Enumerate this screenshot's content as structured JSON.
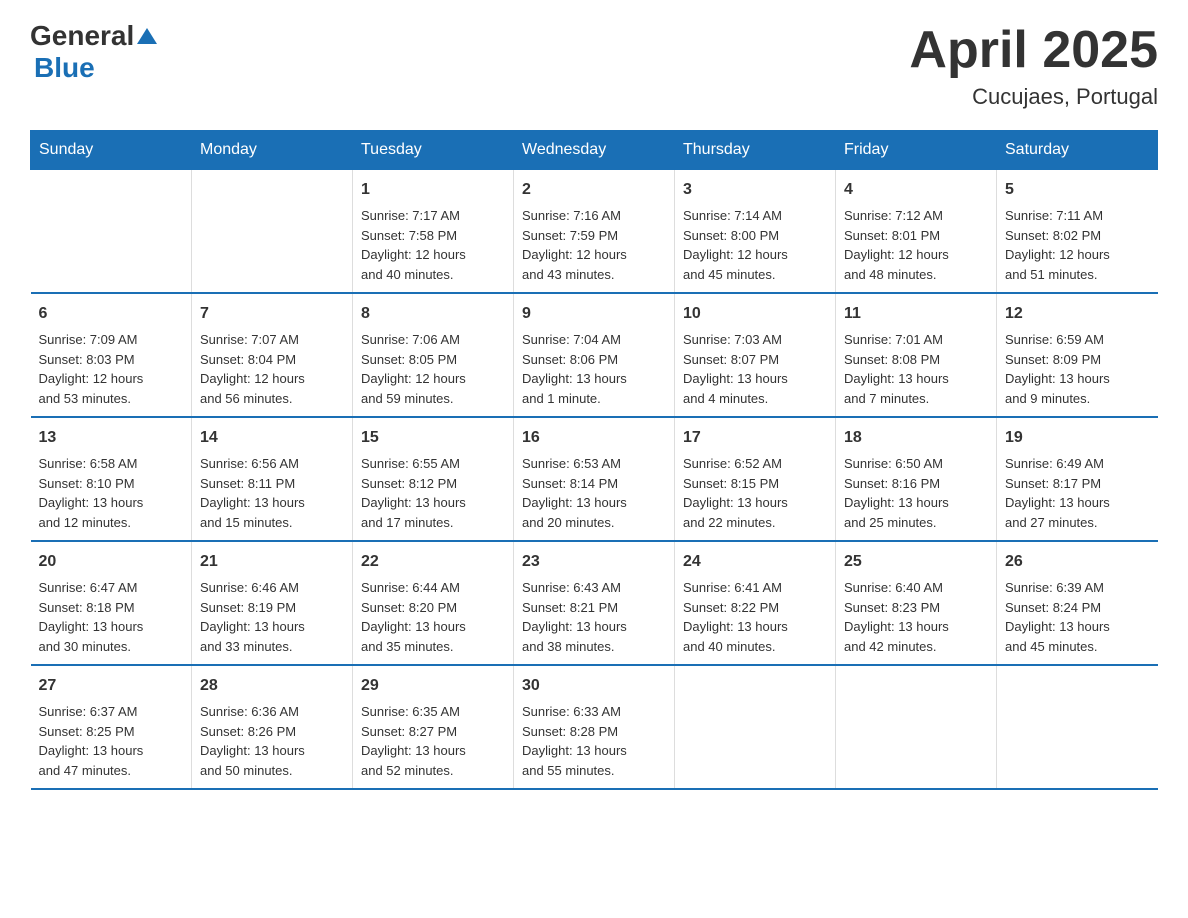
{
  "header": {
    "title": "April 2025",
    "subtitle": "Cucujaes, Portugal",
    "logo_general": "General",
    "logo_blue": "Blue"
  },
  "weekdays": [
    "Sunday",
    "Monday",
    "Tuesday",
    "Wednesday",
    "Thursday",
    "Friday",
    "Saturday"
  ],
  "weeks": [
    [
      {
        "day": "",
        "info": ""
      },
      {
        "day": "",
        "info": ""
      },
      {
        "day": "1",
        "info": "Sunrise: 7:17 AM\nSunset: 7:58 PM\nDaylight: 12 hours\nand 40 minutes."
      },
      {
        "day": "2",
        "info": "Sunrise: 7:16 AM\nSunset: 7:59 PM\nDaylight: 12 hours\nand 43 minutes."
      },
      {
        "day": "3",
        "info": "Sunrise: 7:14 AM\nSunset: 8:00 PM\nDaylight: 12 hours\nand 45 minutes."
      },
      {
        "day": "4",
        "info": "Sunrise: 7:12 AM\nSunset: 8:01 PM\nDaylight: 12 hours\nand 48 minutes."
      },
      {
        "day": "5",
        "info": "Sunrise: 7:11 AM\nSunset: 8:02 PM\nDaylight: 12 hours\nand 51 minutes."
      }
    ],
    [
      {
        "day": "6",
        "info": "Sunrise: 7:09 AM\nSunset: 8:03 PM\nDaylight: 12 hours\nand 53 minutes."
      },
      {
        "day": "7",
        "info": "Sunrise: 7:07 AM\nSunset: 8:04 PM\nDaylight: 12 hours\nand 56 minutes."
      },
      {
        "day": "8",
        "info": "Sunrise: 7:06 AM\nSunset: 8:05 PM\nDaylight: 12 hours\nand 59 minutes."
      },
      {
        "day": "9",
        "info": "Sunrise: 7:04 AM\nSunset: 8:06 PM\nDaylight: 13 hours\nand 1 minute."
      },
      {
        "day": "10",
        "info": "Sunrise: 7:03 AM\nSunset: 8:07 PM\nDaylight: 13 hours\nand 4 minutes."
      },
      {
        "day": "11",
        "info": "Sunrise: 7:01 AM\nSunset: 8:08 PM\nDaylight: 13 hours\nand 7 minutes."
      },
      {
        "day": "12",
        "info": "Sunrise: 6:59 AM\nSunset: 8:09 PM\nDaylight: 13 hours\nand 9 minutes."
      }
    ],
    [
      {
        "day": "13",
        "info": "Sunrise: 6:58 AM\nSunset: 8:10 PM\nDaylight: 13 hours\nand 12 minutes."
      },
      {
        "day": "14",
        "info": "Sunrise: 6:56 AM\nSunset: 8:11 PM\nDaylight: 13 hours\nand 15 minutes."
      },
      {
        "day": "15",
        "info": "Sunrise: 6:55 AM\nSunset: 8:12 PM\nDaylight: 13 hours\nand 17 minutes."
      },
      {
        "day": "16",
        "info": "Sunrise: 6:53 AM\nSunset: 8:14 PM\nDaylight: 13 hours\nand 20 minutes."
      },
      {
        "day": "17",
        "info": "Sunrise: 6:52 AM\nSunset: 8:15 PM\nDaylight: 13 hours\nand 22 minutes."
      },
      {
        "day": "18",
        "info": "Sunrise: 6:50 AM\nSunset: 8:16 PM\nDaylight: 13 hours\nand 25 minutes."
      },
      {
        "day": "19",
        "info": "Sunrise: 6:49 AM\nSunset: 8:17 PM\nDaylight: 13 hours\nand 27 minutes."
      }
    ],
    [
      {
        "day": "20",
        "info": "Sunrise: 6:47 AM\nSunset: 8:18 PM\nDaylight: 13 hours\nand 30 minutes."
      },
      {
        "day": "21",
        "info": "Sunrise: 6:46 AM\nSunset: 8:19 PM\nDaylight: 13 hours\nand 33 minutes."
      },
      {
        "day": "22",
        "info": "Sunrise: 6:44 AM\nSunset: 8:20 PM\nDaylight: 13 hours\nand 35 minutes."
      },
      {
        "day": "23",
        "info": "Sunrise: 6:43 AM\nSunset: 8:21 PM\nDaylight: 13 hours\nand 38 minutes."
      },
      {
        "day": "24",
        "info": "Sunrise: 6:41 AM\nSunset: 8:22 PM\nDaylight: 13 hours\nand 40 minutes."
      },
      {
        "day": "25",
        "info": "Sunrise: 6:40 AM\nSunset: 8:23 PM\nDaylight: 13 hours\nand 42 minutes."
      },
      {
        "day": "26",
        "info": "Sunrise: 6:39 AM\nSunset: 8:24 PM\nDaylight: 13 hours\nand 45 minutes."
      }
    ],
    [
      {
        "day": "27",
        "info": "Sunrise: 6:37 AM\nSunset: 8:25 PM\nDaylight: 13 hours\nand 47 minutes."
      },
      {
        "day": "28",
        "info": "Sunrise: 6:36 AM\nSunset: 8:26 PM\nDaylight: 13 hours\nand 50 minutes."
      },
      {
        "day": "29",
        "info": "Sunrise: 6:35 AM\nSunset: 8:27 PM\nDaylight: 13 hours\nand 52 minutes."
      },
      {
        "day": "30",
        "info": "Sunrise: 6:33 AM\nSunset: 8:28 PM\nDaylight: 13 hours\nand 55 minutes."
      },
      {
        "day": "",
        "info": ""
      },
      {
        "day": "",
        "info": ""
      },
      {
        "day": "",
        "info": ""
      }
    ]
  ],
  "colors": {
    "header_bg": "#1a6fb5",
    "header_text": "#ffffff",
    "border": "#1a6fb5",
    "title_color": "#333333",
    "logo_blue": "#1a6fb5"
  }
}
